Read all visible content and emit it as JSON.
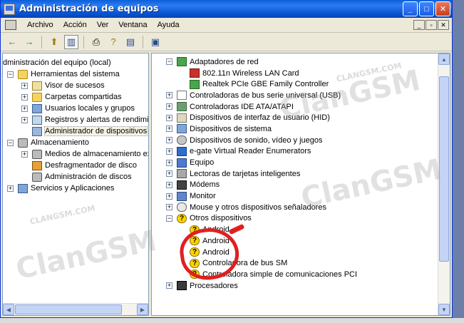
{
  "window": {
    "title": "Administración de equipos",
    "buttons": {
      "minimize": "_",
      "maximize": "□",
      "close": "✕"
    }
  },
  "menubar": {
    "items": [
      "Archivo",
      "Acción",
      "Ver",
      "Ventana",
      "Ayuda"
    ],
    "mdi": [
      "_",
      "▫",
      "✕"
    ]
  },
  "toolbar": {
    "back": "←",
    "forward": "→",
    "up": "⬆",
    "show_hide_tree": "▥",
    "print": "⎙",
    "help": "?",
    "properties": "▤",
    "scan": "▣"
  },
  "left_tree": {
    "root": "dministración del equipo (local)",
    "items": [
      {
        "label": "Herramientas del sistema",
        "level": 1,
        "expander": "−",
        "icon": "i-folder"
      },
      {
        "label": "Visor de sucesos",
        "level": 2,
        "expander": "+",
        "icon": "i-event"
      },
      {
        "label": "Carpetas compartidas",
        "level": 2,
        "expander": "+",
        "icon": "i-folder"
      },
      {
        "label": "Usuarios locales y grupos",
        "level": 2,
        "expander": "+",
        "icon": "i-sys"
      },
      {
        "label": "Registros y alertas de rendimiento",
        "level": 2,
        "expander": "+",
        "icon": "i-log"
      },
      {
        "label": "Administrador de dispositivos",
        "level": 2,
        "expander": "",
        "icon": "i-comp",
        "selected": true
      },
      {
        "label": "Almacenamiento",
        "level": 1,
        "expander": "−",
        "icon": "i-disk"
      },
      {
        "label": "Medios de almacenamiento extraíb",
        "level": 2,
        "expander": "+",
        "icon": "i-disk"
      },
      {
        "label": "Desfragmentador de disco",
        "level": 2,
        "expander": "",
        "icon": "i-defrag"
      },
      {
        "label": "Administración de discos",
        "level": 2,
        "expander": "",
        "icon": "i-disk"
      },
      {
        "label": "Servicios y Aplicaciones",
        "level": 1,
        "expander": "+",
        "icon": "i-sys"
      }
    ]
  },
  "right_tree": {
    "items": [
      {
        "label": "Adaptadores de red",
        "level": 0,
        "expander": "−",
        "icon": "i-net"
      },
      {
        "label": "802.11n Wireless LAN Card",
        "level": 1,
        "expander": "",
        "icon": "i-netred"
      },
      {
        "label": "Realtek PCIe GBE Family Controller",
        "level": 1,
        "expander": "",
        "icon": "i-net"
      },
      {
        "label": "Controladoras de bus serie universal (USB)",
        "level": 0,
        "expander": "+",
        "icon": "i-usb"
      },
      {
        "label": "Controladoras IDE ATA/ATAPI",
        "level": 0,
        "expander": "+",
        "icon": "i-ide"
      },
      {
        "label": "Dispositivos de interfaz de usuario (HID)",
        "level": 0,
        "expander": "+",
        "icon": "i-hid"
      },
      {
        "label": "Dispositivos de sistema",
        "level": 0,
        "expander": "+",
        "icon": "i-sys"
      },
      {
        "label": "Dispositivos de sonido, vídeo y juegos",
        "level": 0,
        "expander": "+",
        "icon": "i-snd"
      },
      {
        "label": "e-gate Virtual Reader Enumerators",
        "level": 0,
        "expander": "+",
        "icon": "i-egate"
      },
      {
        "label": "Equipo",
        "level": 0,
        "expander": "+",
        "icon": "i-pc"
      },
      {
        "label": "Lectoras de tarjetas inteligentes",
        "level": 0,
        "expander": "+",
        "icon": "i-card"
      },
      {
        "label": "Módems",
        "level": 0,
        "expander": "+",
        "icon": "i-modem"
      },
      {
        "label": "Monitor",
        "level": 0,
        "expander": "+",
        "icon": "i-mon"
      },
      {
        "label": "Mouse y otros dispositivos señaladores",
        "level": 0,
        "expander": "+",
        "icon": "i-mouse"
      },
      {
        "label": "Otros dispositivos",
        "level": 0,
        "expander": "−",
        "icon": "i-q"
      },
      {
        "label": "Android",
        "level": 1,
        "expander": "",
        "icon": "i-q"
      },
      {
        "label": "Android",
        "level": 1,
        "expander": "",
        "icon": "i-q"
      },
      {
        "label": "Android",
        "level": 1,
        "expander": "",
        "icon": "i-q"
      },
      {
        "label": "Controladora de bus SM",
        "level": 1,
        "expander": "",
        "icon": "i-q"
      },
      {
        "label": "Controladora simple de comunicaciones PCI",
        "level": 1,
        "expander": "",
        "icon": "i-q"
      },
      {
        "label": "Procesadores",
        "level": 0,
        "expander": "+",
        "icon": "i-cpu"
      }
    ]
  },
  "watermark": {
    "brand": "ClanGSM",
    "small": "CLANGSM.COM"
  }
}
